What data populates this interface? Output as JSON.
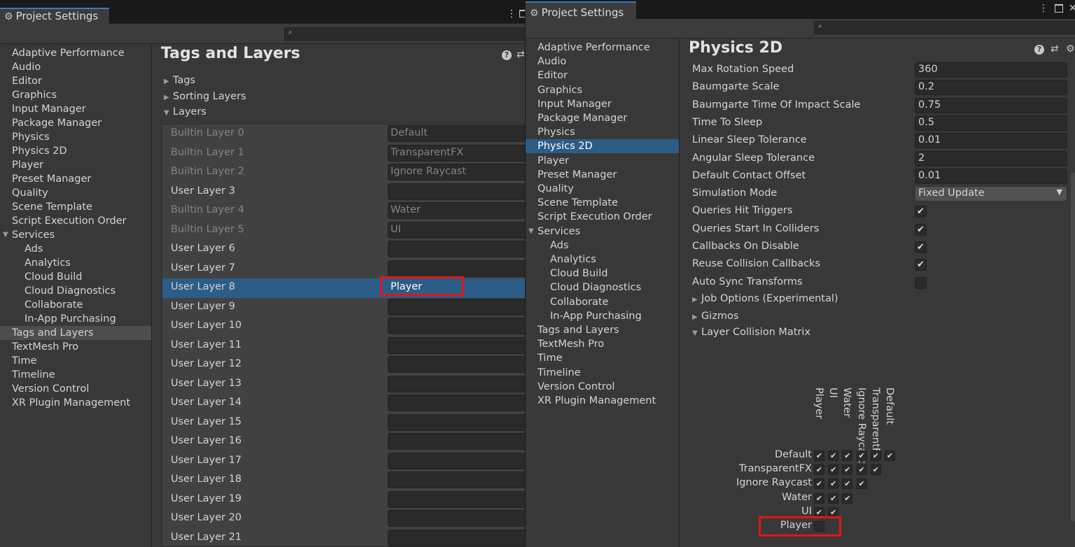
{
  "left_window": {
    "tab_title": "Project Settings",
    "header_title": "Tags and Layers",
    "nav_items": [
      {
        "label": "Adaptive Performance",
        "level": 0
      },
      {
        "label": "Audio",
        "level": 0
      },
      {
        "label": "Editor",
        "level": 0
      },
      {
        "label": "Graphics",
        "level": 0
      },
      {
        "label": "Input Manager",
        "level": 0
      },
      {
        "label": "Package Manager",
        "level": 0
      },
      {
        "label": "Physics",
        "level": 0
      },
      {
        "label": "Physics 2D",
        "level": 0
      },
      {
        "label": "Player",
        "level": 0
      },
      {
        "label": "Preset Manager",
        "level": 0
      },
      {
        "label": "Quality",
        "level": 0
      },
      {
        "label": "Scene Template",
        "level": 0
      },
      {
        "label": "Script Execution Order",
        "level": 0
      },
      {
        "label": "Services",
        "level": 0,
        "expanded": true
      },
      {
        "label": "Ads",
        "level": 1
      },
      {
        "label": "Analytics",
        "level": 1
      },
      {
        "label": "Cloud Build",
        "level": 1
      },
      {
        "label": "Cloud Diagnostics",
        "level": 1
      },
      {
        "label": "Collaborate",
        "level": 1
      },
      {
        "label": "In-App Purchasing",
        "level": 1
      },
      {
        "label": "Tags and Layers",
        "level": 0,
        "selected": true
      },
      {
        "label": "TextMesh Pro",
        "level": 0
      },
      {
        "label": "Time",
        "level": 0
      },
      {
        "label": "Timeline",
        "level": 0
      },
      {
        "label": "Version Control",
        "level": 0
      },
      {
        "label": "XR Plugin Management",
        "level": 0
      }
    ],
    "sections": [
      {
        "label": "Tags",
        "expanded": false
      },
      {
        "label": "Sorting Layers",
        "expanded": false
      },
      {
        "label": "Layers",
        "expanded": true
      }
    ],
    "layers": [
      {
        "name": "Builtin Layer 0",
        "value": "Default",
        "builtin": true
      },
      {
        "name": "Builtin Layer 1",
        "value": "TransparentFX",
        "builtin": true
      },
      {
        "name": "Builtin Layer 2",
        "value": "Ignore Raycast",
        "builtin": true
      },
      {
        "name": "User Layer 3",
        "value": "",
        "builtin": false
      },
      {
        "name": "Builtin Layer 4",
        "value": "Water",
        "builtin": true
      },
      {
        "name": "Builtin Layer 5",
        "value": "UI",
        "builtin": true
      },
      {
        "name": "User Layer 6",
        "value": "",
        "builtin": false
      },
      {
        "name": "User Layer 7",
        "value": "",
        "builtin": false
      },
      {
        "name": "User Layer 8",
        "value": "Player",
        "builtin": false,
        "selected": true
      },
      {
        "name": "User Layer 9",
        "value": "",
        "builtin": false
      },
      {
        "name": "User Layer 10",
        "value": "",
        "builtin": false
      },
      {
        "name": "User Layer 11",
        "value": "",
        "builtin": false
      },
      {
        "name": "User Layer 12",
        "value": "",
        "builtin": false
      },
      {
        "name": "User Layer 13",
        "value": "",
        "builtin": false
      },
      {
        "name": "User Layer 14",
        "value": "",
        "builtin": false
      },
      {
        "name": "User Layer 15",
        "value": "",
        "builtin": false
      },
      {
        "name": "User Layer 16",
        "value": "",
        "builtin": false
      },
      {
        "name": "User Layer 17",
        "value": "",
        "builtin": false
      },
      {
        "name": "User Layer 18",
        "value": "",
        "builtin": false
      },
      {
        "name": "User Layer 19",
        "value": "",
        "builtin": false
      },
      {
        "name": "User Layer 20",
        "value": "",
        "builtin": false
      },
      {
        "name": "User Layer 21",
        "value": "",
        "builtin": false
      }
    ]
  },
  "right_window": {
    "tab_title": "Project Settings",
    "header_title": "Physics 2D",
    "nav_items": [
      {
        "label": "Adaptive Performance",
        "level": 0
      },
      {
        "label": "Audio",
        "level": 0
      },
      {
        "label": "Editor",
        "level": 0
      },
      {
        "label": "Graphics",
        "level": 0
      },
      {
        "label": "Input Manager",
        "level": 0
      },
      {
        "label": "Package Manager",
        "level": 0
      },
      {
        "label": "Physics",
        "level": 0
      },
      {
        "label": "Physics 2D",
        "level": 0,
        "selected": true
      },
      {
        "label": "Player",
        "level": 0
      },
      {
        "label": "Preset Manager",
        "level": 0
      },
      {
        "label": "Quality",
        "level": 0
      },
      {
        "label": "Scene Template",
        "level": 0
      },
      {
        "label": "Script Execution Order",
        "level": 0
      },
      {
        "label": "Services",
        "level": 0,
        "expanded": true
      },
      {
        "label": "Ads",
        "level": 1
      },
      {
        "label": "Analytics",
        "level": 1
      },
      {
        "label": "Cloud Build",
        "level": 1
      },
      {
        "label": "Cloud Diagnostics",
        "level": 1
      },
      {
        "label": "Collaborate",
        "level": 1
      },
      {
        "label": "In-App Purchasing",
        "level": 1
      },
      {
        "label": "Tags and Layers",
        "level": 0
      },
      {
        "label": "TextMesh Pro",
        "level": 0
      },
      {
        "label": "Time",
        "level": 0
      },
      {
        "label": "Timeline",
        "level": 0
      },
      {
        "label": "Version Control",
        "level": 0
      },
      {
        "label": "XR Plugin Management",
        "level": 0
      }
    ],
    "properties": [
      {
        "label": "Max Rotation Speed",
        "type": "text",
        "value": "360"
      },
      {
        "label": "Baumgarte Scale",
        "type": "text",
        "value": "0.2"
      },
      {
        "label": "Baumgarte Time Of Impact Scale",
        "type": "text",
        "value": "0.75"
      },
      {
        "label": "Time To Sleep",
        "type": "text",
        "value": "0.5"
      },
      {
        "label": "Linear Sleep Tolerance",
        "type": "text",
        "value": "0.01"
      },
      {
        "label": "Angular Sleep Tolerance",
        "type": "text",
        "value": "2"
      },
      {
        "label": "Default Contact Offset",
        "type": "text",
        "value": "0.01"
      },
      {
        "label": "Simulation Mode",
        "type": "dropdown",
        "value": "Fixed Update"
      },
      {
        "label": "Queries Hit Triggers",
        "type": "checkbox",
        "checked": true
      },
      {
        "label": "Queries Start In Colliders",
        "type": "checkbox",
        "checked": true
      },
      {
        "label": "Callbacks On Disable",
        "type": "checkbox",
        "checked": true
      },
      {
        "label": "Reuse Collision Callbacks",
        "type": "checkbox",
        "checked": true
      },
      {
        "label": "Auto Sync Transforms",
        "type": "checkbox",
        "checked": false
      }
    ],
    "foldouts": [
      {
        "label": "Job Options (Experimental)",
        "expanded": false
      },
      {
        "label": "Gizmos",
        "expanded": false
      },
      {
        "label": "Layer Collision Matrix",
        "expanded": true
      }
    ],
    "matrix": {
      "layers": [
        "Default",
        "TransparentFX",
        "Ignore Raycast",
        "Water",
        "UI",
        "Player"
      ],
      "rows": [
        {
          "label": "Default",
          "checks": [
            true,
            true,
            true,
            true,
            true,
            true
          ]
        },
        {
          "label": "TransparentFX",
          "checks": [
            true,
            true,
            true,
            true,
            true
          ]
        },
        {
          "label": "Ignore Raycast",
          "checks": [
            true,
            true,
            true,
            true
          ]
        },
        {
          "label": "Water",
          "checks": [
            true,
            true,
            true
          ]
        },
        {
          "label": "UI",
          "checks": [
            true,
            true
          ]
        },
        {
          "label": "Player",
          "checks": [
            false
          ]
        }
      ]
    }
  },
  "icons": {
    "gear": "⚙",
    "menu": "⋮",
    "help": "?",
    "presets": "⇄",
    "search": "⌕",
    "check": "✔",
    "tri_right": "▶",
    "tri_down": "▼",
    "dropdown": "▼"
  },
  "colors": {
    "accent_tab": "#3a79bb",
    "selection_blue": "#2c5d87",
    "selection_grey": "#4d4d4d",
    "highlight_red": "#e31515"
  }
}
